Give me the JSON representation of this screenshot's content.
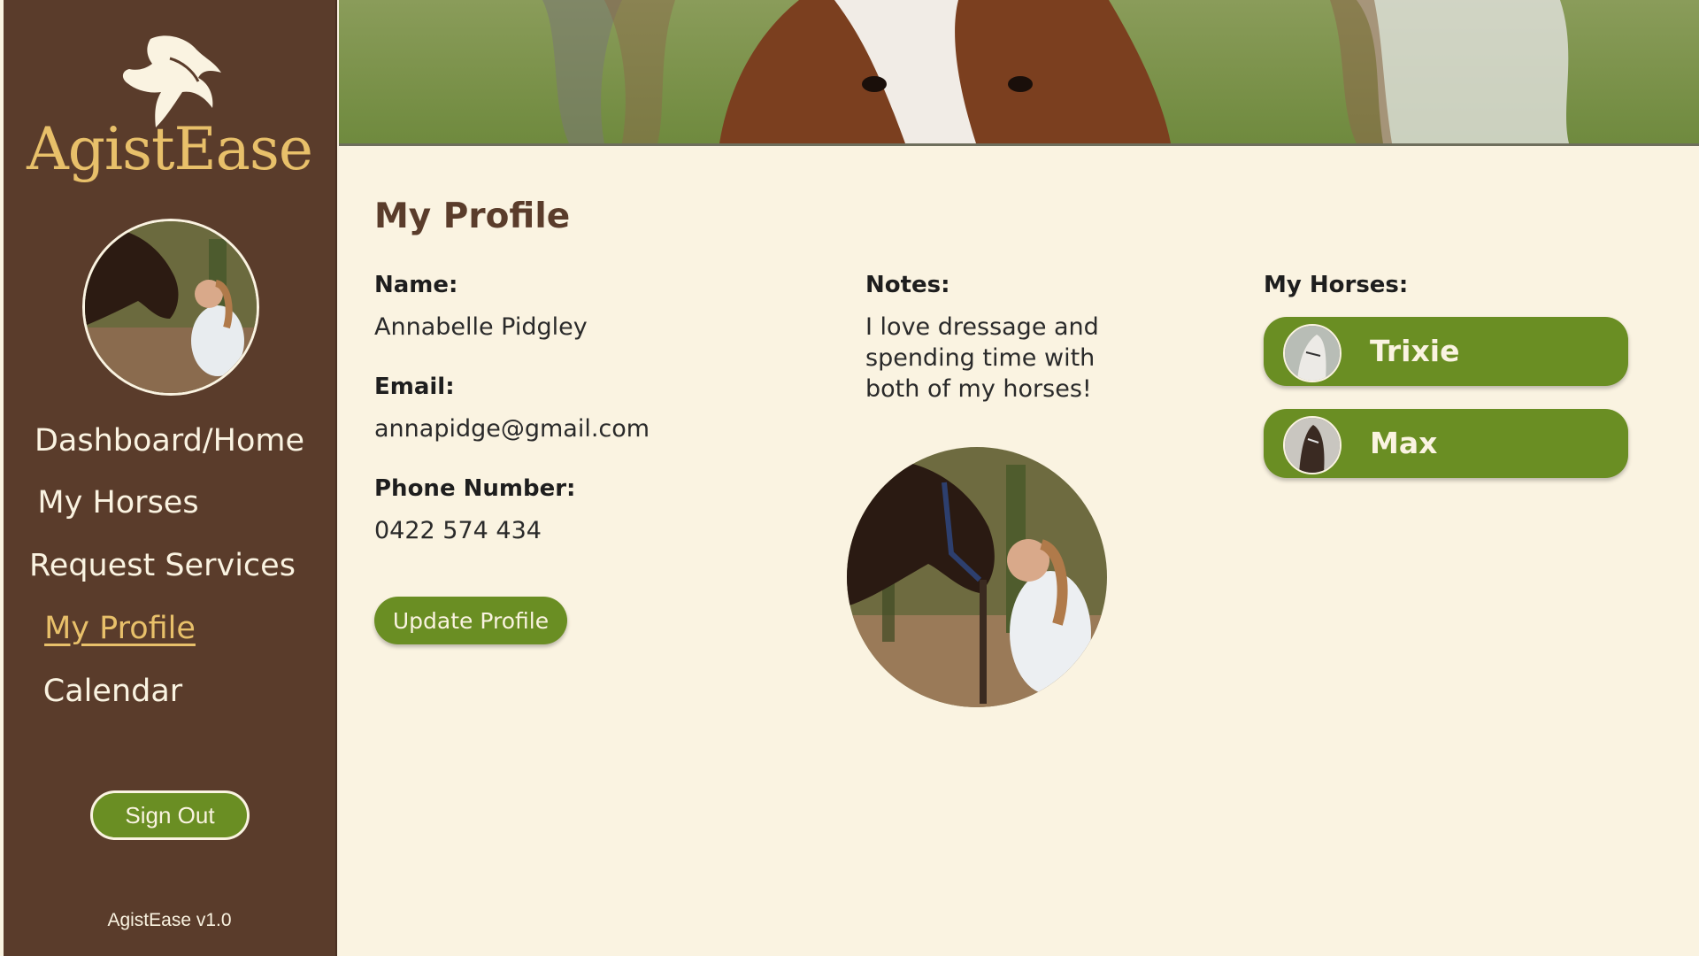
{
  "brand": {
    "name": "AgistEase",
    "version": "AgistEase v1.0"
  },
  "nav": [
    {
      "label": "Dashboard/Home"
    },
    {
      "label": "My Horses"
    },
    {
      "label": "Request Services"
    },
    {
      "label": "My Profile",
      "active": true
    },
    {
      "label": "Calendar"
    }
  ],
  "sidebar": {
    "signout_label": "Sign Out"
  },
  "profile": {
    "title": "My Profile",
    "name_label": "Name:",
    "name": "Annabelle Pidgley",
    "email_label": "Email:",
    "email": "annapidge@gmail.com",
    "phone_label": "Phone Number:",
    "phone": "0422 574 434",
    "update_label": "Update Profile",
    "notes_label": "Notes:",
    "notes_lines": [
      "I love dressage and",
      "spending time with",
      "both of my horses!"
    ]
  },
  "horses": {
    "label": "My Horses:",
    "items": [
      {
        "name": "Trixie"
      },
      {
        "name": "Max"
      }
    ]
  },
  "colors": {
    "sidebar": "#5a3c2b",
    "accent_gold": "#e8c06a",
    "button_green": "#6a8e23",
    "background": "#faf3e1"
  }
}
